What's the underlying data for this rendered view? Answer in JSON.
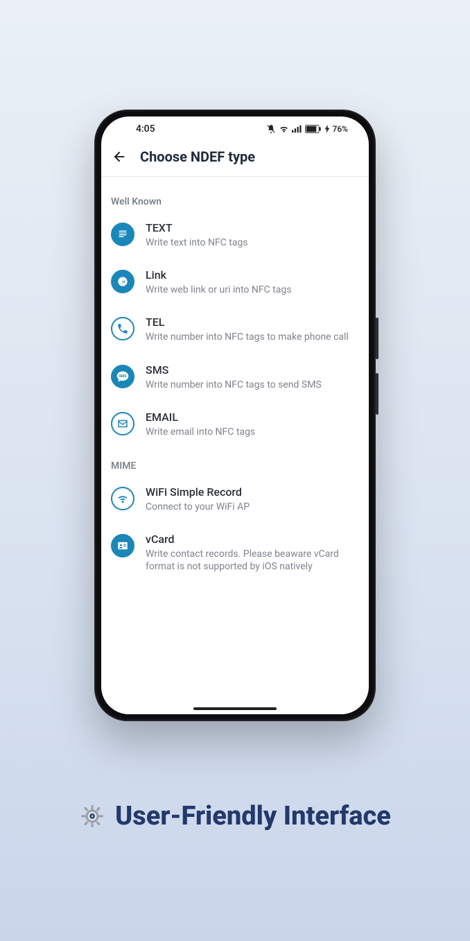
{
  "status": {
    "time": "4:05",
    "battery_text": "76%"
  },
  "header": {
    "title": "Choose NDEF type"
  },
  "sections": [
    {
      "label": "Well Known",
      "items": [
        {
          "icon": "text-icon",
          "title": "TEXT",
          "sub": "Write text into NFC tags"
        },
        {
          "icon": "link-icon",
          "title": "Link",
          "sub": "Write web link or uri into NFC tags"
        },
        {
          "icon": "phone-icon",
          "title": "TEL",
          "sub": "Write number into NFC tags to make phone call"
        },
        {
          "icon": "sms-icon",
          "title": "SMS",
          "sub": "Write number into NFC tags to send SMS"
        },
        {
          "icon": "email-icon",
          "title": "EMAIL",
          "sub": "Write email into NFC tags"
        }
      ]
    },
    {
      "label": "MIME",
      "items": [
        {
          "icon": "wifi-icon",
          "title": "WiFi Simple Record",
          "sub": "Connect to your WiFi AP"
        },
        {
          "icon": "vcard-icon",
          "title": "vCard",
          "sub": "Write contact records. Please beaware vCard format is not supported by iOS natively"
        }
      ]
    }
  ],
  "caption": "User-Friendly Interface"
}
